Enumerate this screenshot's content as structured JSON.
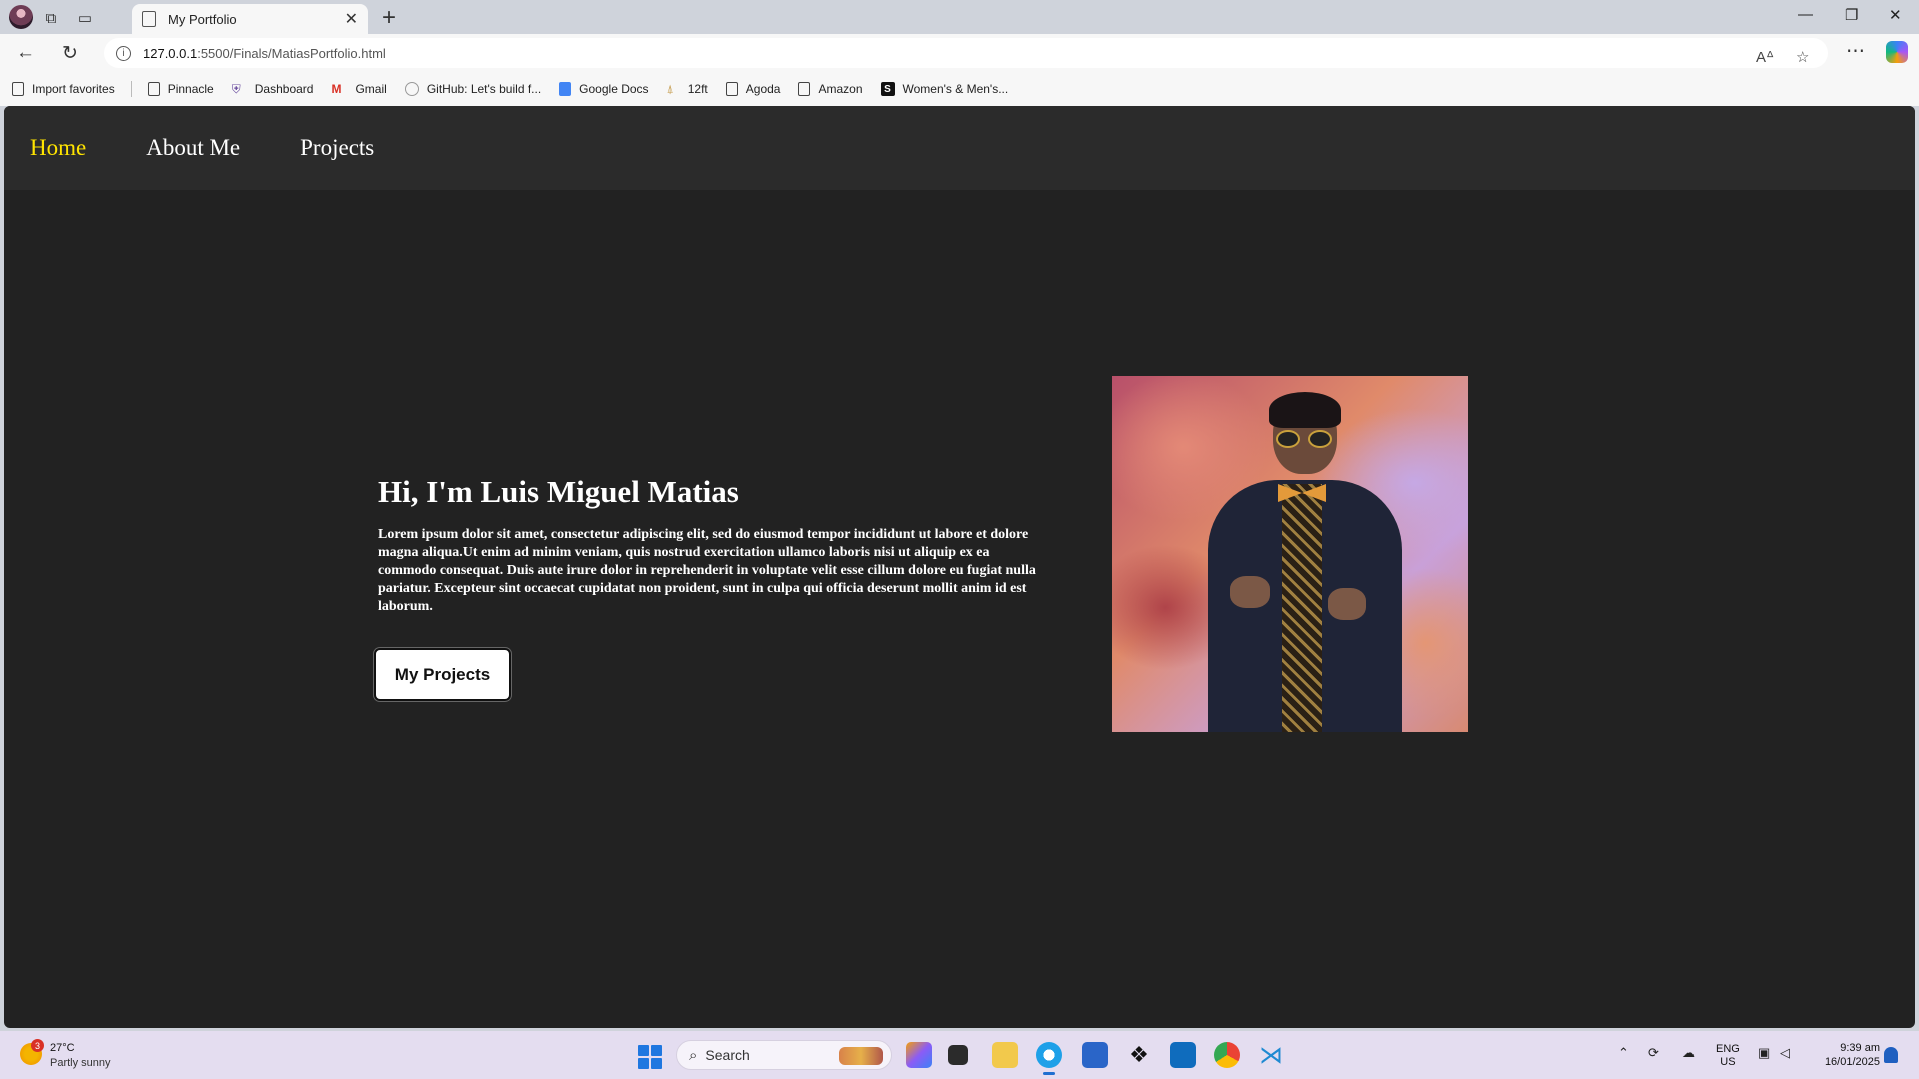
{
  "browser": {
    "tab_title": "My Portfolio",
    "url_host": "127.0.0.1",
    "url_path": ":5500/Finals/MatiasPortfolio.html",
    "favorites": [
      {
        "label": "Import favorites",
        "icon": "import-icon"
      },
      {
        "label": "Pinnacle",
        "icon": "page-icon"
      },
      {
        "label": "Dashboard",
        "icon": "shield-icon"
      },
      {
        "label": "Gmail",
        "icon": "gmail-icon"
      },
      {
        "label": "GitHub: Let's build f...",
        "icon": "github-icon"
      },
      {
        "label": "Google Docs",
        "icon": "google-docs-icon"
      },
      {
        "label": "12ft",
        "icon": "ladder-icon"
      },
      {
        "label": "Agoda",
        "icon": "page-icon"
      },
      {
        "label": "Amazon",
        "icon": "page-icon"
      },
      {
        "label": "Women's & Men's...",
        "icon": "shein-icon"
      }
    ]
  },
  "site": {
    "nav": {
      "home": "Home",
      "about": "About Me",
      "projects": "Projects"
    },
    "accent_color": "#ffe400",
    "background_color": "#222222",
    "hero": {
      "title": "Hi, I'm Luis Miguel Matias",
      "text": "Lorem ipsum dolor sit amet, consectetur adipiscing elit, sed do eiusmod tempor incididunt ut labore et dolore magna aliqua.Ut enim ad minim veniam, quis nostrud exercitation ullamco laboris nisi ut aliquip ex ea commodo consequat. Duis aute irure dolor in reprehenderit in voluptate velit esse cillum dolore eu fugiat nulla pariatur. Excepteur sint occaecat cupidatat non proident, sunt in culpa qui officia deserunt mollit anim id est laborum.",
      "button": "My Projects"
    }
  },
  "taskbar": {
    "weather_badge": "3",
    "weather_temp": "27°C",
    "weather_desc": "Partly sunny",
    "search_placeholder": "Search",
    "lang_line1": "ENG",
    "lang_line2": "US",
    "time": "9:39 am",
    "date": "16/01/2025"
  }
}
